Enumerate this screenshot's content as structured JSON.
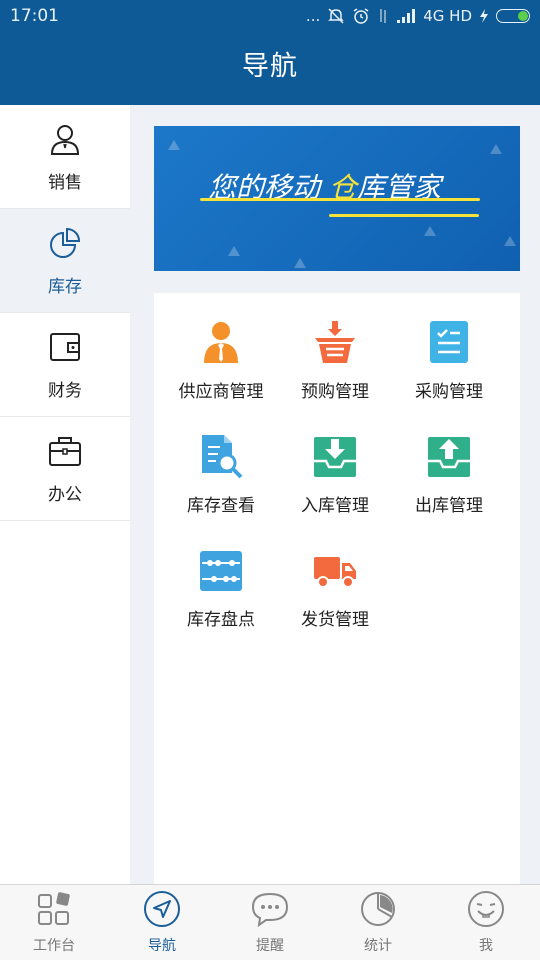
{
  "status_bar": {
    "time": "17:01",
    "dots": "...",
    "network": "4G HD",
    "icons": [
      "mute-icon",
      "alarm-icon",
      "data-arrows-icon",
      "signal-icon",
      "charging-icon",
      "battery-icon"
    ]
  },
  "header": {
    "title": "导航"
  },
  "sidebar": {
    "items": [
      {
        "label": "销售",
        "icon": "user-icon",
        "active": false
      },
      {
        "label": "库存",
        "icon": "pie-chart-icon",
        "active": true
      },
      {
        "label": "财务",
        "icon": "wallet-icon",
        "active": false
      },
      {
        "label": "办公",
        "icon": "briefcase-icon",
        "active": false
      }
    ]
  },
  "banner": {
    "text_part1": "您的移动",
    "text_part2": "仓",
    "text_part3": "库管家"
  },
  "grid": {
    "items": [
      {
        "label": "供应商管理",
        "icon": "supplier-icon"
      },
      {
        "label": "预购管理",
        "icon": "basket-icon"
      },
      {
        "label": "采购管理",
        "icon": "checklist-icon"
      },
      {
        "label": "库存查看",
        "icon": "document-search-icon"
      },
      {
        "label": "入库管理",
        "icon": "inbox-in-icon"
      },
      {
        "label": "出库管理",
        "icon": "inbox-out-icon"
      },
      {
        "label": "库存盘点",
        "icon": "abacus-icon"
      },
      {
        "label": "发货管理",
        "icon": "truck-icon"
      }
    ]
  },
  "tabbar": {
    "items": [
      {
        "label": "工作台",
        "icon": "grid-icon",
        "active": false
      },
      {
        "label": "导航",
        "icon": "navigation-icon",
        "active": true
      },
      {
        "label": "提醒",
        "icon": "chat-bubble-icon",
        "active": false
      },
      {
        "label": "统计",
        "icon": "pie-chart-icon",
        "active": false
      },
      {
        "label": "我",
        "icon": "smiley-icon",
        "active": false
      }
    ]
  },
  "colors": {
    "header_bg": "#0e5a97",
    "accent": "#1b5e99",
    "orange": "#f5912b",
    "teal": "#2fb08a",
    "sky": "#3fb3e6"
  }
}
